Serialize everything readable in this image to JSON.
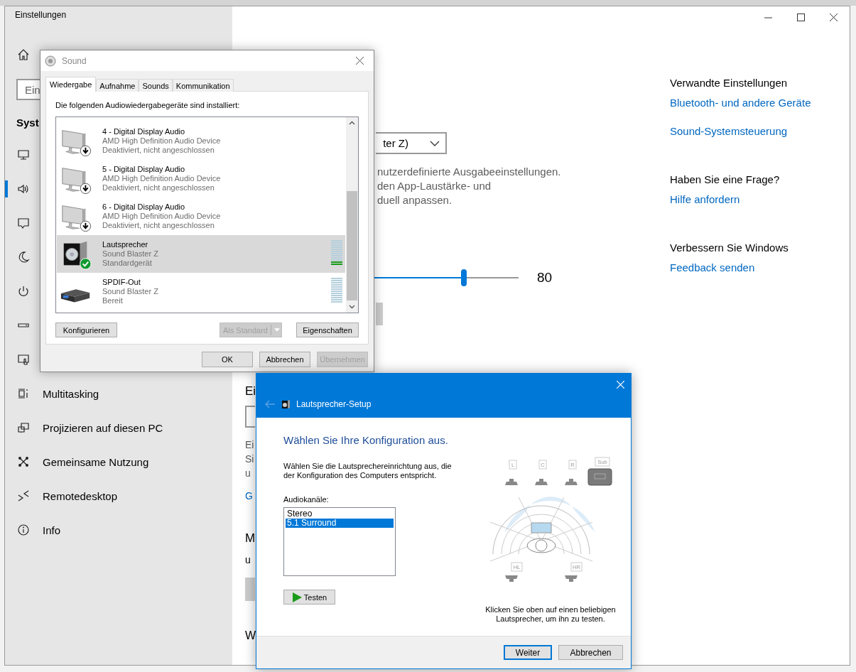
{
  "settings": {
    "title": "Einstellungen",
    "search": {
      "placeholder": "Ein"
    },
    "section_heading": "Syst",
    "nav": [
      {
        "selected": false
      },
      {
        "selected": true
      },
      {
        "selected": false
      },
      {
        "selected": false
      },
      {
        "selected": false
      },
      {
        "selected": false
      },
      {
        "selected": false
      },
      {
        "label": "Multitasking",
        "selected": false
      },
      {
        "label": "Projizieren auf diesen PC",
        "selected": false
      },
      {
        "label": "Gemeinsame Nutzung",
        "selected": false
      },
      {
        "label": "Remotedesktop",
        "selected": false
      },
      {
        "label": "Info",
        "selected": false
      }
    ],
    "output": {
      "device": "ter Z)",
      "description": [
        "nutzerdefinierte Ausgabeeinstellungen.",
        "den App-Laustärke- und",
        "duell anpassen."
      ],
      "volume": {
        "level": 0.8,
        "reading": "80"
      }
    },
    "input": {
      "heading": "Ei",
      "description": [
        "Ei",
        "Si",
        "u"
      ],
      "link": "G"
    },
    "section_3": {
      "heading": "M",
      "text": "u"
    },
    "section_4": {
      "heading": "W"
    },
    "related": [
      {
        "heading": "Verwandte Einstellungen",
        "links": [
          "Bluetooth- und andere Geräte",
          "Sound-Systemsteuerung"
        ]
      },
      {
        "heading": "Haben Sie eine Frage?",
        "links": [
          "Hilfe anfordern"
        ]
      },
      {
        "heading": "Verbessern Sie Windows",
        "links": [
          "Feedback senden"
        ]
      }
    ]
  },
  "sound_dialog": {
    "title": "Sound",
    "tabs": [
      {
        "label": "Wiedergabe",
        "selected": true
      },
      {
        "label": "Aufnahme",
        "selected": false
      },
      {
        "label": "Sounds",
        "selected": false
      },
      {
        "label": "Kommunikation",
        "selected": false
      }
    ],
    "intro": "Die folgenden Audiowiedergabegeräte sind installiert:",
    "devices": [
      {
        "kind": "monitor",
        "name": "4 - Digital Display Audio",
        "driver": "AMD High Definition Audio Device",
        "status": "Deaktiviert, nicht angeschlossen",
        "disabled": true,
        "default": false,
        "selected": false
      },
      {
        "kind": "monitor",
        "name": "5 - Digital Display Audio",
        "driver": "AMD High Definition Audio Device",
        "status": "Deaktiviert, nicht angeschlossen",
        "disabled": true,
        "default": false,
        "selected": false
      },
      {
        "kind": "monitor",
        "name": "6 - Digital Display Audio",
        "driver": "AMD High Definition Audio Device",
        "status": "Deaktiviert, nicht angeschlossen",
        "disabled": true,
        "default": false,
        "selected": false
      },
      {
        "kind": "speaker",
        "name": "Lautsprecher",
        "driver": "Sound Blaster Z",
        "status": "Standardgerät",
        "disabled": false,
        "default": true,
        "selected": true,
        "level": 0.17
      },
      {
        "kind": "spdif",
        "name": "SPDIF-Out",
        "driver": "Sound Blaster Z",
        "status": "Bereit",
        "disabled": false,
        "default": false,
        "selected": false,
        "level": 0
      }
    ],
    "actions": [
      {
        "label": "Konfigurieren",
        "disabled": false
      },
      {
        "label": "Als Standard",
        "disabled": true,
        "kind": "split"
      },
      {
        "label": "Eigenschaften",
        "disabled": false
      }
    ],
    "buttons": [
      {
        "label": "OK",
        "disabled": false
      },
      {
        "label": "Abbrechen",
        "disabled": false
      },
      {
        "label": "Übernehmen",
        "disabled": true
      }
    ]
  },
  "speaker_setup": {
    "title": "Lautsprecher-Setup",
    "heading": "Wählen Sie Ihre Konfiguration aus.",
    "instruction": "Wählen Sie die Lautsprechereinrichtung aus, die\nder Konfiguration des Computers entspricht.",
    "channels_label": "Audiokanäle:",
    "channels": [
      {
        "label": "Stereo",
        "selected": false
      },
      {
        "label": "5.1 Surround",
        "selected": true
      }
    ],
    "test_button": "Testen",
    "speakers": [
      {
        "label": "L",
        "kind": "front"
      },
      {
        "label": "C",
        "kind": "front"
      },
      {
        "label": "R",
        "kind": "front"
      },
      {
        "label": "Sub",
        "kind": "sub"
      },
      {
        "label": "HL",
        "kind": "rear"
      },
      {
        "label": "HR",
        "kind": "rear"
      }
    ],
    "hint": "Klicken Sie oben auf einen beliebigen\nLautsprecher, um ihn zu testen.",
    "buttons": [
      {
        "label": "Weiter",
        "default": true
      },
      {
        "label": "Abbrechen",
        "default": false
      }
    ]
  }
}
